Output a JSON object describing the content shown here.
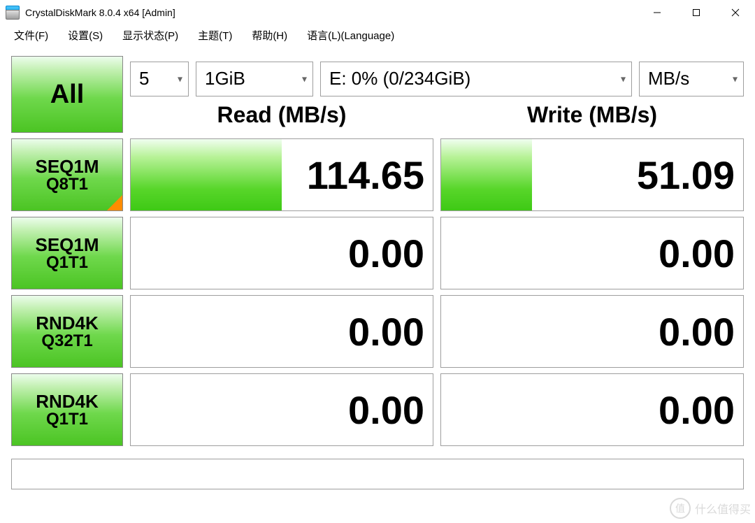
{
  "window": {
    "title": "CrystalDiskMark 8.0.4 x64 [Admin]"
  },
  "menu": {
    "file": "文件(F)",
    "settings": "设置(S)",
    "display": "显示状态(P)",
    "theme": "主题(T)",
    "help": "帮助(H)",
    "language": "语言(L)(Language)"
  },
  "controls": {
    "count": "5",
    "size": "1GiB",
    "drive": "E: 0% (0/234GiB)",
    "unit": "MB/s"
  },
  "headers": {
    "read": "Read (MB/s)",
    "write": "Write (MB/s)"
  },
  "buttons": {
    "all": "All"
  },
  "tests": [
    {
      "l1": "SEQ1M",
      "l2": "Q8T1",
      "read": "114.65",
      "read_pct": 50,
      "write": "51.09",
      "write_pct": 30,
      "corner": true
    },
    {
      "l1": "SEQ1M",
      "l2": "Q1T1",
      "read": "0.00",
      "read_pct": 0,
      "write": "0.00",
      "write_pct": 0,
      "corner": false
    },
    {
      "l1": "RND4K",
      "l2": "Q32T1",
      "read": "0.00",
      "read_pct": 0,
      "write": "0.00",
      "write_pct": 0,
      "corner": false
    },
    {
      "l1": "RND4K",
      "l2": "Q1T1",
      "read": "0.00",
      "read_pct": 0,
      "write": "0.00",
      "write_pct": 0,
      "corner": false
    }
  ],
  "watermark": {
    "badge": "值",
    "text": "什么值得买"
  }
}
